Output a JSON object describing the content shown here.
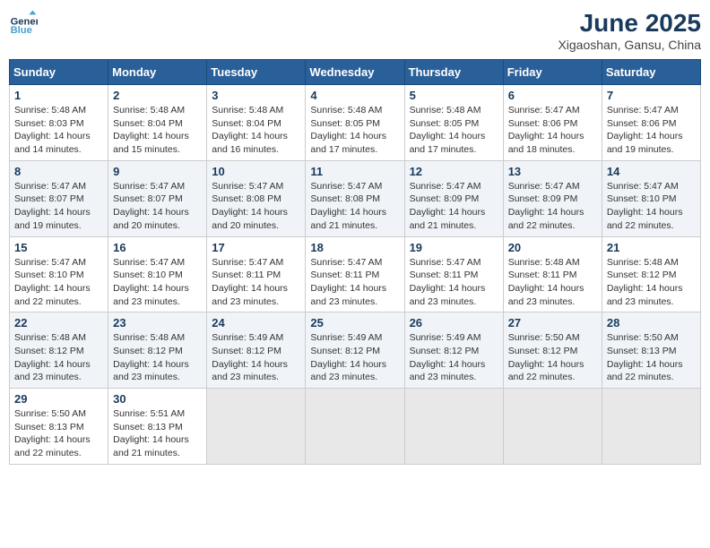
{
  "logo": {
    "text_general": "General",
    "text_blue": "Blue"
  },
  "header": {
    "month_year": "June 2025",
    "location": "Xigaoshan, Gansu, China"
  },
  "weekdays": [
    "Sunday",
    "Monday",
    "Tuesday",
    "Wednesday",
    "Thursday",
    "Friday",
    "Saturday"
  ],
  "weeks": [
    [
      {
        "day": "1",
        "sunrise": "Sunrise: 5:48 AM",
        "sunset": "Sunset: 8:03 PM",
        "daylight": "Daylight: 14 hours and 14 minutes."
      },
      {
        "day": "2",
        "sunrise": "Sunrise: 5:48 AM",
        "sunset": "Sunset: 8:04 PM",
        "daylight": "Daylight: 14 hours and 15 minutes."
      },
      {
        "day": "3",
        "sunrise": "Sunrise: 5:48 AM",
        "sunset": "Sunset: 8:04 PM",
        "daylight": "Daylight: 14 hours and 16 minutes."
      },
      {
        "day": "4",
        "sunrise": "Sunrise: 5:48 AM",
        "sunset": "Sunset: 8:05 PM",
        "daylight": "Daylight: 14 hours and 17 minutes."
      },
      {
        "day": "5",
        "sunrise": "Sunrise: 5:48 AM",
        "sunset": "Sunset: 8:05 PM",
        "daylight": "Daylight: 14 hours and 17 minutes."
      },
      {
        "day": "6",
        "sunrise": "Sunrise: 5:47 AM",
        "sunset": "Sunset: 8:06 PM",
        "daylight": "Daylight: 14 hours and 18 minutes."
      },
      {
        "day": "7",
        "sunrise": "Sunrise: 5:47 AM",
        "sunset": "Sunset: 8:06 PM",
        "daylight": "Daylight: 14 hours and 19 minutes."
      }
    ],
    [
      {
        "day": "8",
        "sunrise": "Sunrise: 5:47 AM",
        "sunset": "Sunset: 8:07 PM",
        "daylight": "Daylight: 14 hours and 19 minutes."
      },
      {
        "day": "9",
        "sunrise": "Sunrise: 5:47 AM",
        "sunset": "Sunset: 8:07 PM",
        "daylight": "Daylight: 14 hours and 20 minutes."
      },
      {
        "day": "10",
        "sunrise": "Sunrise: 5:47 AM",
        "sunset": "Sunset: 8:08 PM",
        "daylight": "Daylight: 14 hours and 20 minutes."
      },
      {
        "day": "11",
        "sunrise": "Sunrise: 5:47 AM",
        "sunset": "Sunset: 8:08 PM",
        "daylight": "Daylight: 14 hours and 21 minutes."
      },
      {
        "day": "12",
        "sunrise": "Sunrise: 5:47 AM",
        "sunset": "Sunset: 8:09 PM",
        "daylight": "Daylight: 14 hours and 21 minutes."
      },
      {
        "day": "13",
        "sunrise": "Sunrise: 5:47 AM",
        "sunset": "Sunset: 8:09 PM",
        "daylight": "Daylight: 14 hours and 22 minutes."
      },
      {
        "day": "14",
        "sunrise": "Sunrise: 5:47 AM",
        "sunset": "Sunset: 8:10 PM",
        "daylight": "Daylight: 14 hours and 22 minutes."
      }
    ],
    [
      {
        "day": "15",
        "sunrise": "Sunrise: 5:47 AM",
        "sunset": "Sunset: 8:10 PM",
        "daylight": "Daylight: 14 hours and 22 minutes."
      },
      {
        "day": "16",
        "sunrise": "Sunrise: 5:47 AM",
        "sunset": "Sunset: 8:10 PM",
        "daylight": "Daylight: 14 hours and 23 minutes."
      },
      {
        "day": "17",
        "sunrise": "Sunrise: 5:47 AM",
        "sunset": "Sunset: 8:11 PM",
        "daylight": "Daylight: 14 hours and 23 minutes."
      },
      {
        "day": "18",
        "sunrise": "Sunrise: 5:47 AM",
        "sunset": "Sunset: 8:11 PM",
        "daylight": "Daylight: 14 hours and 23 minutes."
      },
      {
        "day": "19",
        "sunrise": "Sunrise: 5:47 AM",
        "sunset": "Sunset: 8:11 PM",
        "daylight": "Daylight: 14 hours and 23 minutes."
      },
      {
        "day": "20",
        "sunrise": "Sunrise: 5:48 AM",
        "sunset": "Sunset: 8:11 PM",
        "daylight": "Daylight: 14 hours and 23 minutes."
      },
      {
        "day": "21",
        "sunrise": "Sunrise: 5:48 AM",
        "sunset": "Sunset: 8:12 PM",
        "daylight": "Daylight: 14 hours and 23 minutes."
      }
    ],
    [
      {
        "day": "22",
        "sunrise": "Sunrise: 5:48 AM",
        "sunset": "Sunset: 8:12 PM",
        "daylight": "Daylight: 14 hours and 23 minutes."
      },
      {
        "day": "23",
        "sunrise": "Sunrise: 5:48 AM",
        "sunset": "Sunset: 8:12 PM",
        "daylight": "Daylight: 14 hours and 23 minutes."
      },
      {
        "day": "24",
        "sunrise": "Sunrise: 5:49 AM",
        "sunset": "Sunset: 8:12 PM",
        "daylight": "Daylight: 14 hours and 23 minutes."
      },
      {
        "day": "25",
        "sunrise": "Sunrise: 5:49 AM",
        "sunset": "Sunset: 8:12 PM",
        "daylight": "Daylight: 14 hours and 23 minutes."
      },
      {
        "day": "26",
        "sunrise": "Sunrise: 5:49 AM",
        "sunset": "Sunset: 8:12 PM",
        "daylight": "Daylight: 14 hours and 23 minutes."
      },
      {
        "day": "27",
        "sunrise": "Sunrise: 5:50 AM",
        "sunset": "Sunset: 8:12 PM",
        "daylight": "Daylight: 14 hours and 22 minutes."
      },
      {
        "day": "28",
        "sunrise": "Sunrise: 5:50 AM",
        "sunset": "Sunset: 8:13 PM",
        "daylight": "Daylight: 14 hours and 22 minutes."
      }
    ],
    [
      {
        "day": "29",
        "sunrise": "Sunrise: 5:50 AM",
        "sunset": "Sunset: 8:13 PM",
        "daylight": "Daylight: 14 hours and 22 minutes."
      },
      {
        "day": "30",
        "sunrise": "Sunrise: 5:51 AM",
        "sunset": "Sunset: 8:13 PM",
        "daylight": "Daylight: 14 hours and 21 minutes."
      },
      null,
      null,
      null,
      null,
      null
    ]
  ]
}
